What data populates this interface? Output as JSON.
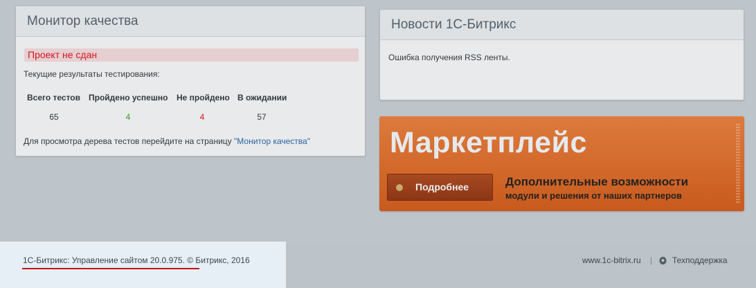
{
  "quality": {
    "title": "Монитор качества",
    "status": "Проект не сдан",
    "current_results": "Текущие результаты тестирования:",
    "columns": [
      "Всего тестов",
      "Пройдено успешно",
      "Не пройдено",
      "В ожидании"
    ],
    "values": [
      "65",
      "4",
      "4",
      "57"
    ],
    "hint_text": "Для просмотра дерева тестов перейдите на страницу ",
    "hint_link": "\"Монитор качества\""
  },
  "news": {
    "title": "Новости 1С-Битрикс",
    "error": "Ошибка получения RSS ленты."
  },
  "market": {
    "title": "Маркетплейс",
    "button": "Подробнее",
    "subtitle": "Дополнительные возможности",
    "subtitle2": "модули и решения от наших партнеров"
  },
  "footer": {
    "copyright": "1С-Битрикс: Управление сайтом 20.0.975. © Битрикс, 2016",
    "site_link": "www.1c-bitrix.ru",
    "separator": "|",
    "support": "Техподдержка"
  },
  "colors": {
    "status_red": "#d5151f",
    "passed_green": "#3a9a1d",
    "link_blue": "#2a62a6",
    "market_orange": "#d2692b"
  }
}
